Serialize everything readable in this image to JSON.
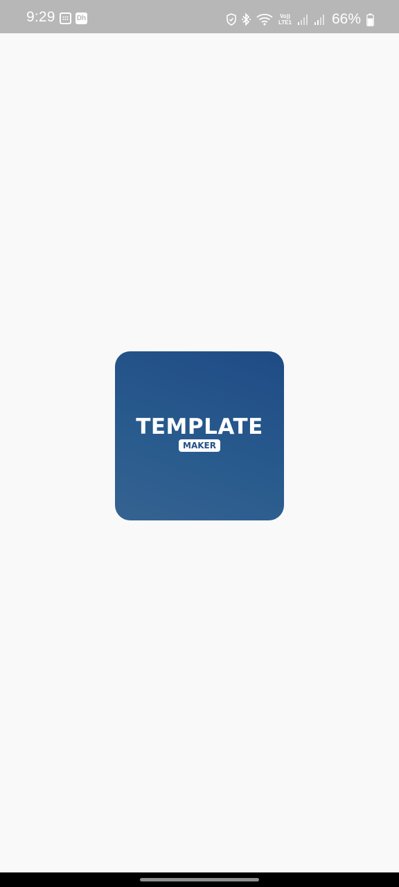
{
  "status_bar": {
    "time": "9:29",
    "notification_icons": [
      "app-grid-icon",
      "dh-app-icon"
    ],
    "dh_icon_text": "Dh",
    "right_icons": [
      "shield-icon",
      "bluetooth-icon",
      "wifi-icon",
      "volte-icon",
      "signal-1-icon",
      "signal-2-icon",
      "battery-icon"
    ],
    "volte_line1": "Vo))",
    "volte_line2": "LTE1",
    "battery": "66%"
  },
  "splash": {
    "title": "TEMPLATE",
    "subtitle": "MAKER",
    "colors": {
      "tile_start": "#356391",
      "tile_end": "#1f4b85",
      "background": "#f9f9f9"
    }
  },
  "navigation": {
    "home_indicator": "home-indicator"
  }
}
